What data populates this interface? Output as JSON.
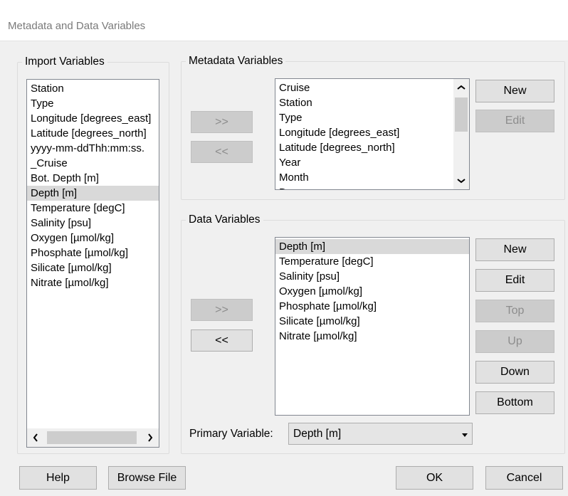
{
  "window": {
    "title": "Metadata and Data Variables"
  },
  "import_group": {
    "legend": "Import Variables",
    "items": [
      "Station",
      "Type",
      "Longitude [degrees_east]",
      "Latitude [degrees_north]",
      "yyyy-mm-ddThh:mm:ss.",
      "_Cruise",
      "Bot. Depth [m]",
      "Depth [m]",
      "Temperature [degC]",
      "Salinity [psu]",
      "Oxygen [µmol/kg]",
      "Phosphate [µmol/kg]",
      "Silicate [µmol/kg]",
      "Nitrate [µmol/kg]"
    ],
    "selected": "Depth [m]"
  },
  "metadata_group": {
    "legend": "Metadata Variables",
    "add_label": ">>",
    "remove_label": "<<",
    "items": [
      "Cruise",
      "Station",
      "Type",
      "Longitude [degrees_east]",
      "Latitude [degrees_north]",
      "Year",
      "Month",
      "Day"
    ],
    "new_label": "New",
    "edit_label": "Edit"
  },
  "data_group": {
    "legend": "Data Variables",
    "add_label": ">>",
    "remove_label": "<<",
    "items": [
      "Depth [m]",
      "Temperature [degC]",
      "Salinity [psu]",
      "Oxygen [µmol/kg]",
      "Phosphate [µmol/kg]",
      "Silicate [µmol/kg]",
      "Nitrate [µmol/kg]"
    ],
    "selected": "Depth [m]",
    "new_label": "New",
    "edit_label": "Edit",
    "top_label": "Top",
    "up_label": "Up",
    "down_label": "Down",
    "bottom_label": "Bottom",
    "primary_label": "Primary Variable:",
    "primary_value": "Depth [m]"
  },
  "footer": {
    "help_label": "Help",
    "browse_label": "Browse File",
    "ok_label": "OK",
    "cancel_label": "Cancel"
  }
}
